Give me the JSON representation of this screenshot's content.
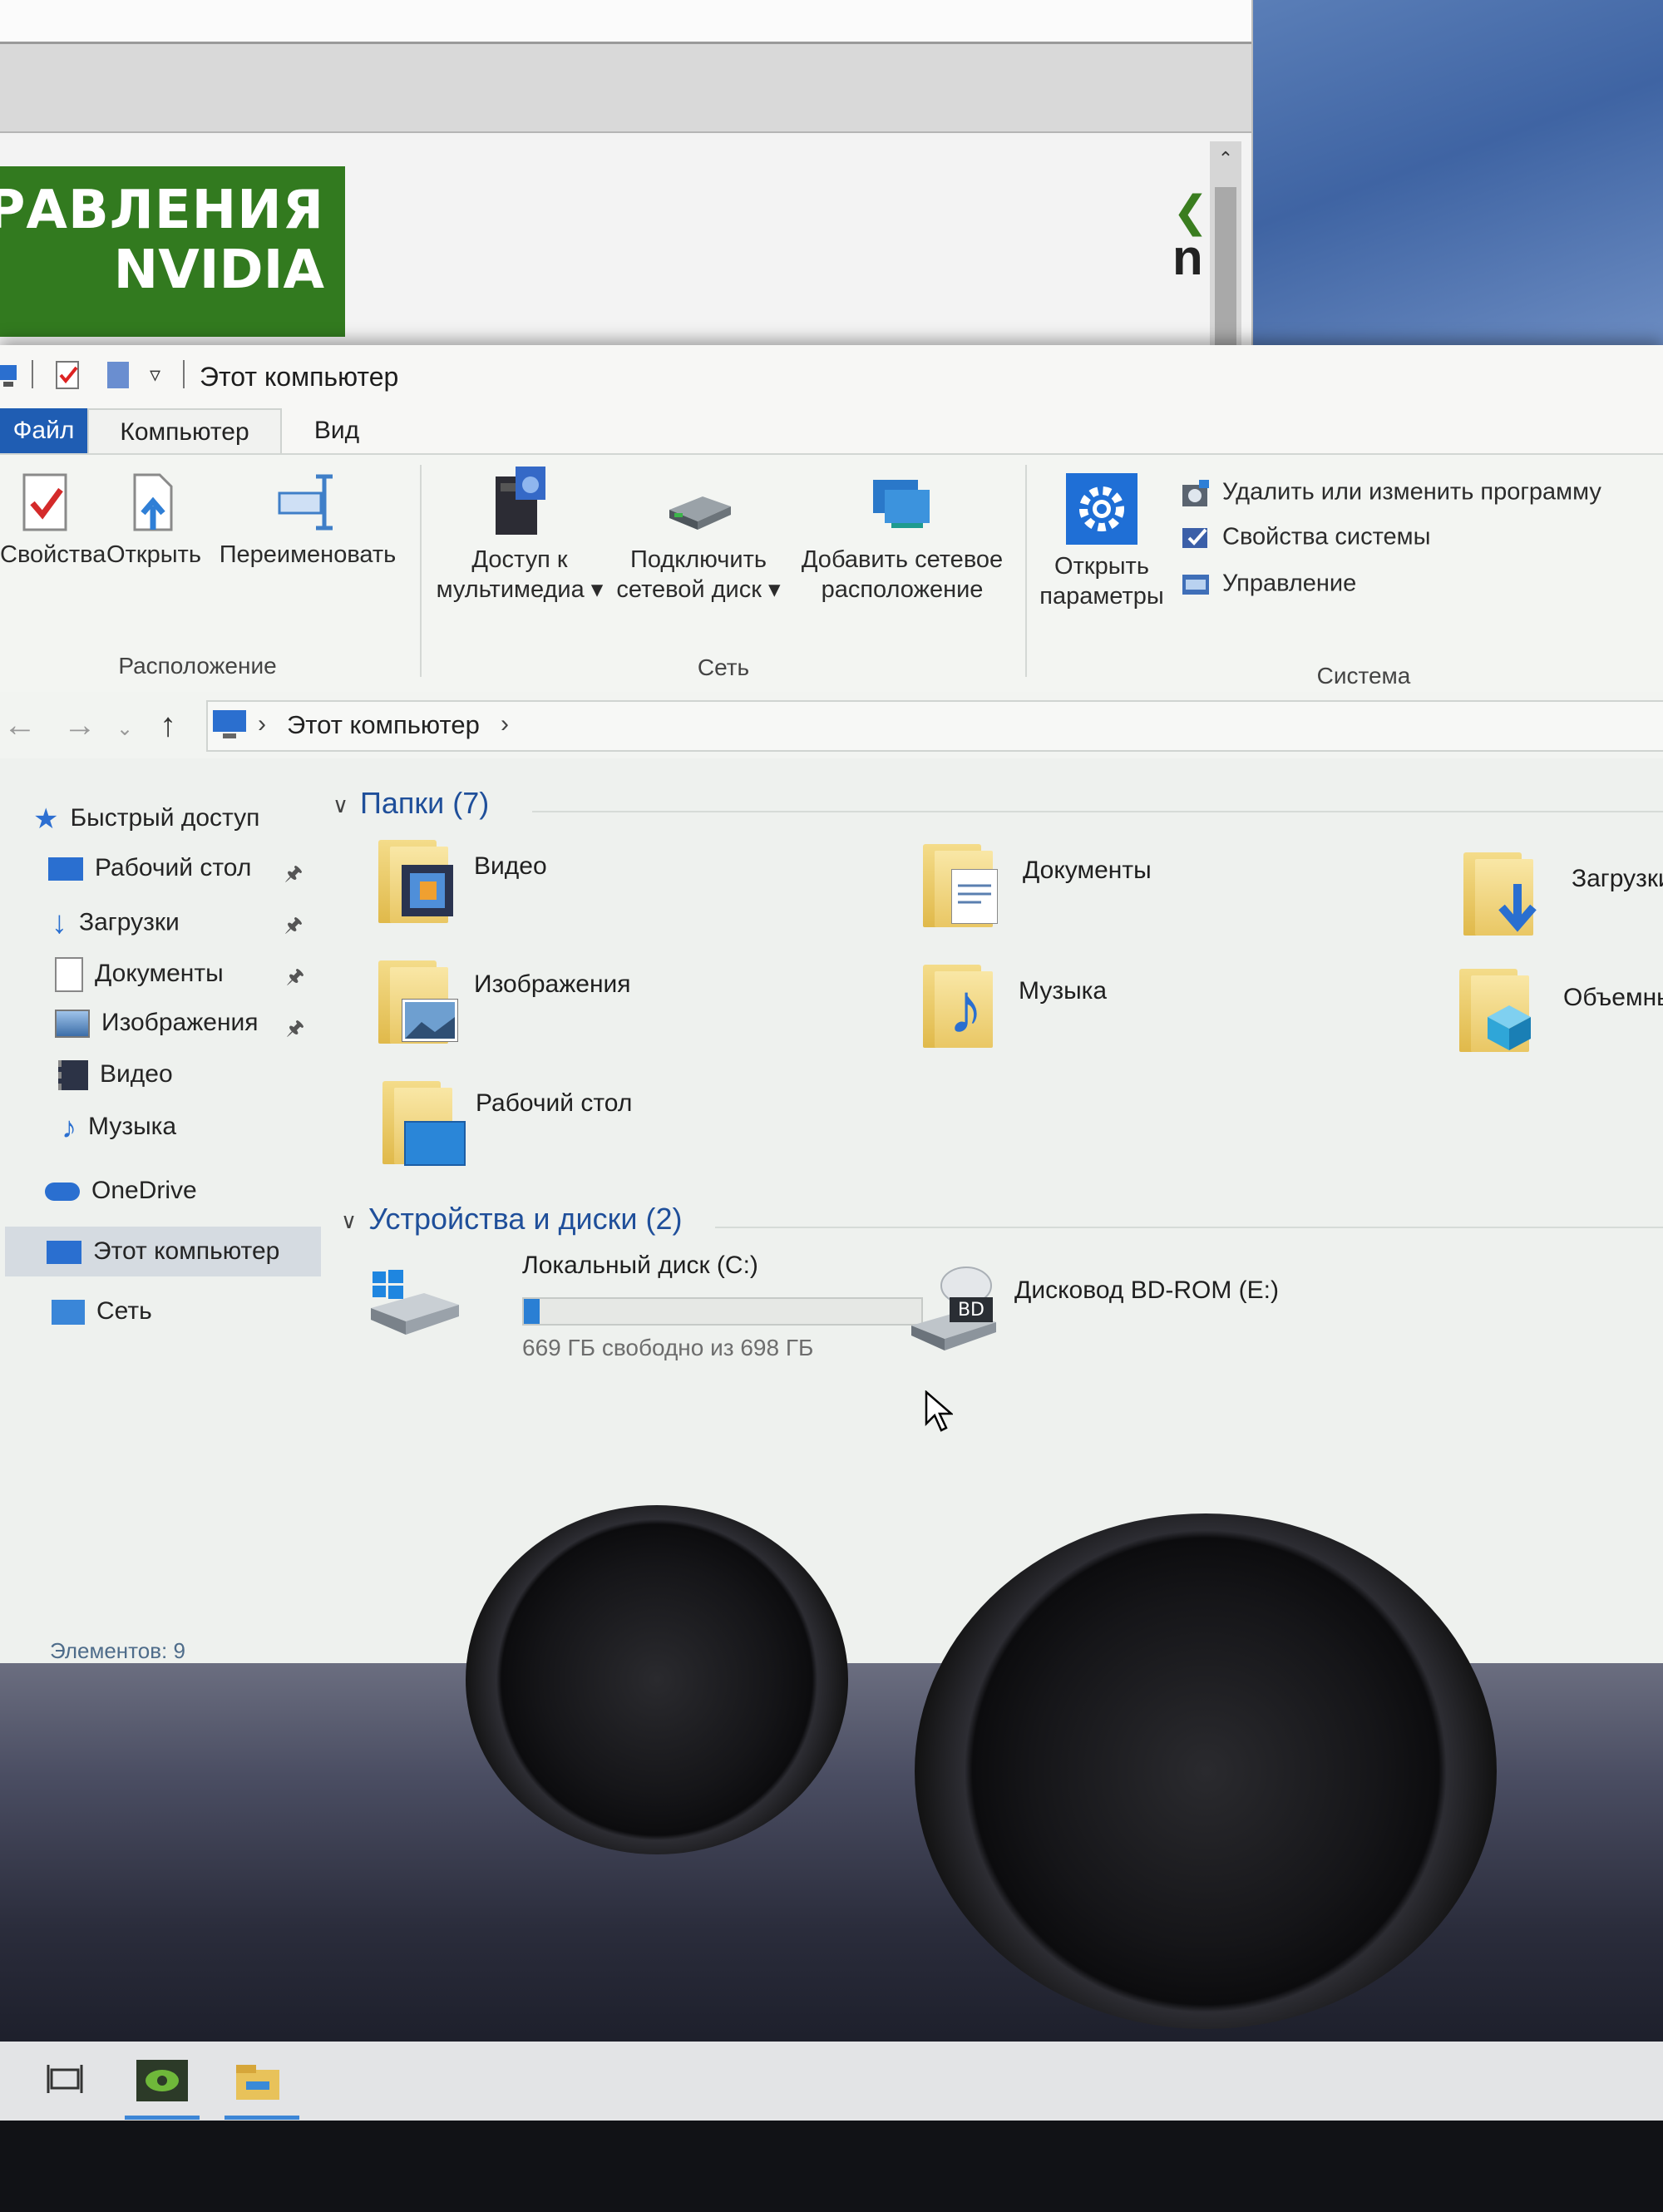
{
  "nvidia_window": {
    "banner_line1": "ПРАВЛЕНИЯ",
    "banner_line2": "NVIDIA",
    "logo_fragment": "n"
  },
  "explorer": {
    "title": "Этот компьютер",
    "tabs": [
      {
        "label": "Файл"
      },
      {
        "label": "Компьютер"
      },
      {
        "label": "Вид"
      }
    ],
    "ribbon": {
      "location": {
        "label": "Расположение",
        "buttons": [
          {
            "label": "Свойства",
            "icon": "properties-icon"
          },
          {
            "label": "Открыть",
            "icon": "open-icon"
          },
          {
            "label": "Переименовать",
            "icon": "rename-icon"
          }
        ]
      },
      "network": {
        "label": "Сеть",
        "buttons": [
          {
            "line1": "Доступ к",
            "line2": "мультимедиа ▾",
            "icon": "media-access-icon"
          },
          {
            "line1": "Подключить",
            "line2": "сетевой диск ▾",
            "icon": "map-network-drive-icon"
          },
          {
            "line1": "Добавить сетевое",
            "line2": "расположение",
            "icon": "add-network-location-icon"
          }
        ]
      },
      "system": {
        "label": "Система",
        "open_settings_line1": "Открыть",
        "open_settings_line2": "параметры",
        "items": [
          {
            "label": "Удалить или изменить программу",
            "icon": "uninstall-icon"
          },
          {
            "label": "Свойства системы",
            "icon": "system-properties-icon"
          },
          {
            "label": "Управление",
            "icon": "manage-icon"
          }
        ]
      }
    },
    "address": {
      "path": "Этот компьютер",
      "separator": "›"
    },
    "nav": {
      "quick_access": "Быстрый доступ",
      "items": [
        {
          "label": "Рабочий стол",
          "pinned": true
        },
        {
          "label": "Загрузки",
          "pinned": true
        },
        {
          "label": "Документы",
          "pinned": true
        },
        {
          "label": "Изображения",
          "pinned": true
        },
        {
          "label": "Видео",
          "pinned": false
        },
        {
          "label": "Музыка",
          "pinned": false
        }
      ],
      "onedrive": "OneDrive",
      "this_pc": "Этот компьютер",
      "network": "Сеть"
    },
    "folders": {
      "header": "Папки (7)",
      "items": [
        {
          "label": "Видео"
        },
        {
          "label": "Документы"
        },
        {
          "label": "Загрузки"
        },
        {
          "label": "Изображения"
        },
        {
          "label": "Музыка"
        },
        {
          "label": "Объемны"
        },
        {
          "label": "Рабочий стол"
        }
      ]
    },
    "devices": {
      "header": "Устройства и диски (2)",
      "drives": [
        {
          "label": "Локальный диск (C:)",
          "free_text": "669 ГБ свободно из 698 ГБ",
          "used_fraction": 0.04
        },
        {
          "label": "Дисковод BD-ROM (E:)",
          "badge": "BD"
        }
      ]
    },
    "status": "Элементов: 9"
  },
  "colors": {
    "accent": "#1f5db3",
    "nvidia_green": "#327a1f",
    "drive_fill": "#2a7fd4",
    "header_blue": "#1f4f9a"
  }
}
